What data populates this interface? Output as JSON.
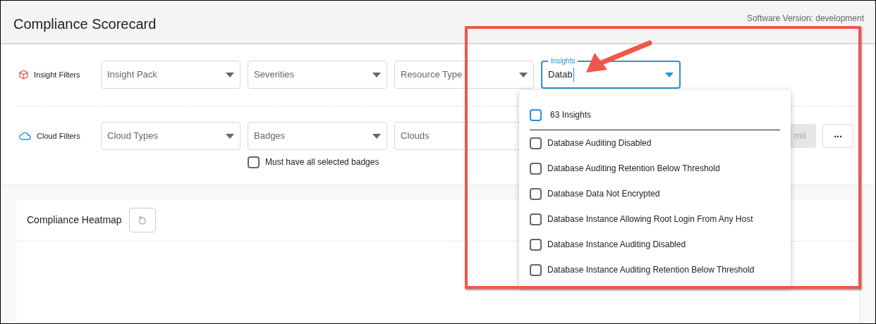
{
  "header": {
    "title": "Compliance Scorecard",
    "version": "Software Version: development"
  },
  "filter_groups": [
    {
      "label": "Insight Filters",
      "kind": "insight",
      "fields": [
        {
          "placeholder": "Insight Pack",
          "focused": false
        },
        {
          "placeholder": "Severities",
          "focused": false
        },
        {
          "placeholder": "Resource Type",
          "focused": false
        },
        {
          "label": "Insights",
          "value": "Datab",
          "focused": true
        }
      ]
    },
    {
      "label": "Cloud Filters",
      "kind": "cloud",
      "fields": [
        {
          "placeholder": "Cloud Types",
          "focused": false
        },
        {
          "placeholder": "Badges",
          "focused": false
        },
        {
          "placeholder": "Clouds",
          "focused": false
        }
      ]
    }
  ],
  "badges_checkbox": {
    "label": "Must have all selected badges",
    "checked": false
  },
  "submit_button": {
    "label": "mit",
    "disabled": true
  },
  "more_button": {
    "label": "..."
  },
  "heatmap": {
    "title": "Compliance Heatmap"
  },
  "insights_dropdown": {
    "select_all": {
      "label": "63 Insights",
      "checked": false
    },
    "options": [
      {
        "label": "Database Auditing Disabled",
        "checked": false
      },
      {
        "label": "Database Auditing Retention Below Threshold",
        "checked": false
      },
      {
        "label": "Database Data Not Encrypted",
        "checked": false
      },
      {
        "label": "Database Instance Allowing Root Login From Any Host",
        "checked": false
      },
      {
        "label": "Database Instance Auditing Disabled",
        "checked": false
      },
      {
        "label": "Database Instance Auditing Retention Below Threshold",
        "checked": false
      }
    ]
  }
}
